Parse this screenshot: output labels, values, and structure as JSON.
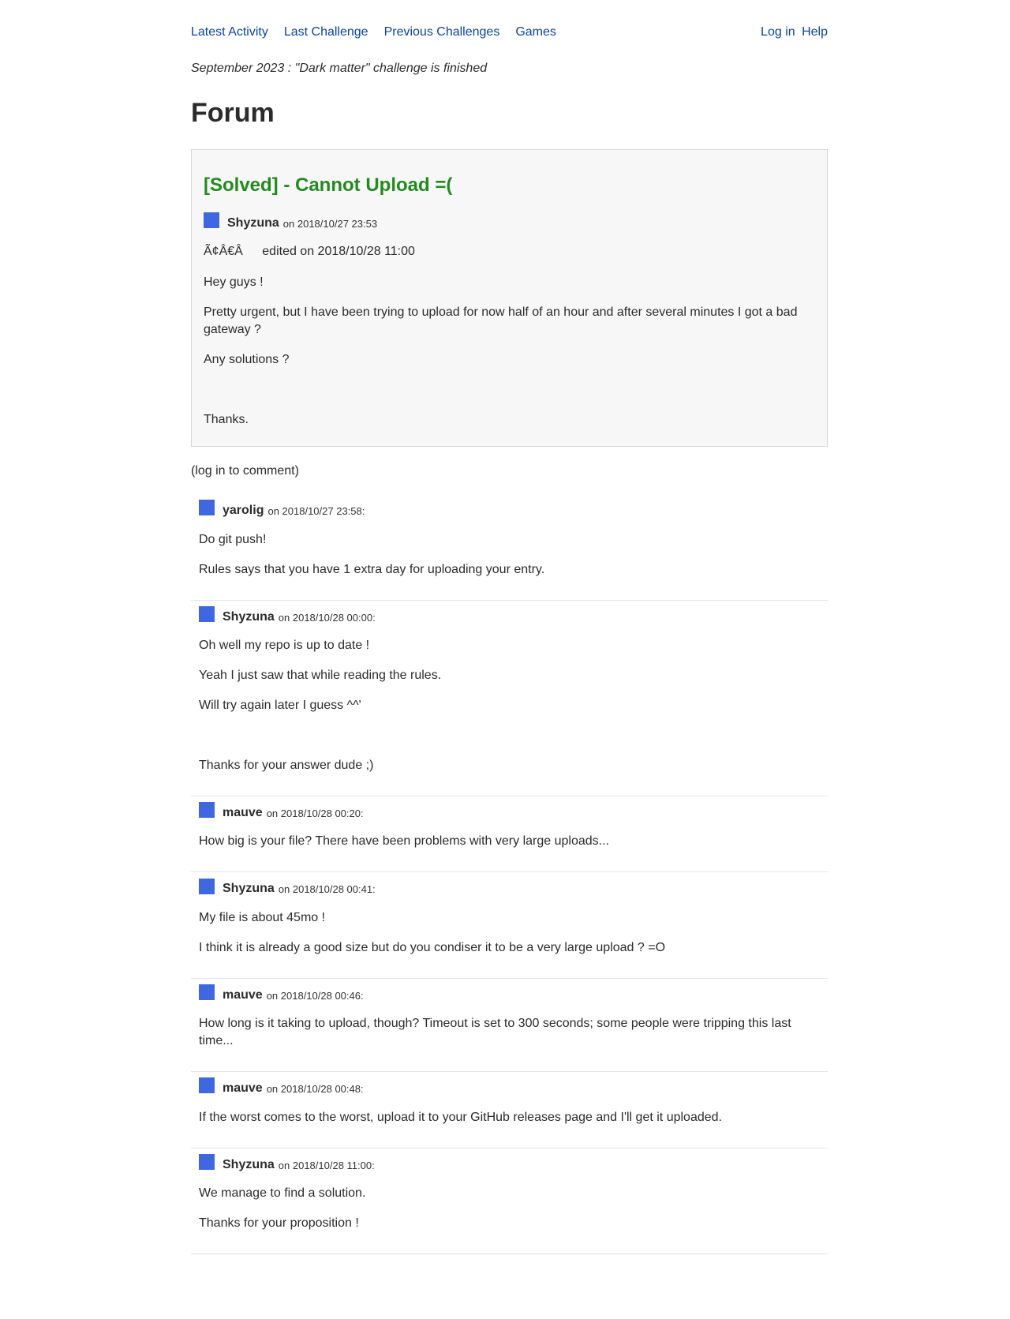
{
  "nav": {
    "latest": "Latest Activity",
    "last_challenge": "Last Challenge",
    "previous": "Previous Challenges",
    "games": "Games",
    "login": "Log in",
    "help": "Help"
  },
  "news": "September 2023 : \"Dark matter\" challenge is finished",
  "page_title": "Forum",
  "thread": {
    "title": "[Solved] - Cannot Upload =(",
    "author": "Shyzuna",
    "date": "on 2018/10/27 23:53",
    "edited_glyph": "Ã¢Â€Â",
    "edited": "edited on 2018/10/28 11:00",
    "paragraphs": [
      "Hey guys !",
      "Pretty urgent, but I have been trying to upload for now half of an hour and after several minutes I got a bad gateway ?",
      "Any solutions ?",
      "",
      "Thanks."
    ]
  },
  "login_note": "(log in to comment)",
  "comments": [
    {
      "author": "yarolig",
      "date": "on 2018/10/27 23:58:",
      "paragraphs": [
        "Do git push!",
        "Rules says that you have 1 extra day for uploading your entry."
      ]
    },
    {
      "author": "Shyzuna",
      "date": "on 2018/10/28 00:00:",
      "paragraphs": [
        "Oh well my repo is up to date !",
        "Yeah I just saw that while reading the rules.",
        "Will try again later I guess ^^'",
        "",
        "Thanks for your answer dude ;)"
      ]
    },
    {
      "author": "mauve",
      "date": "on 2018/10/28 00:20:",
      "paragraphs": [
        "How big is your file? There have been problems with very large uploads..."
      ]
    },
    {
      "author": "Shyzuna",
      "date": "on 2018/10/28 00:41:",
      "paragraphs": [
        "My file is about 45mo !",
        "I think it is already a good size but do you condiser it to be a very large upload ? =O"
      ]
    },
    {
      "author": "mauve",
      "date": "on 2018/10/28 00:46:",
      "paragraphs": [
        "How long is it taking to upload, though? Timeout is set to 300 seconds; some people were tripping this last time..."
      ]
    },
    {
      "author": "mauve",
      "date": "on 2018/10/28 00:48:",
      "paragraphs": [
        "If the worst comes to the worst, upload it to your GitHub releases page and I'll get it uploaded."
      ]
    },
    {
      "author": "Shyzuna",
      "date": "on 2018/10/28 11:00:",
      "paragraphs": [
        "We manage to find a solution.",
        "Thanks for your proposition !"
      ]
    }
  ]
}
